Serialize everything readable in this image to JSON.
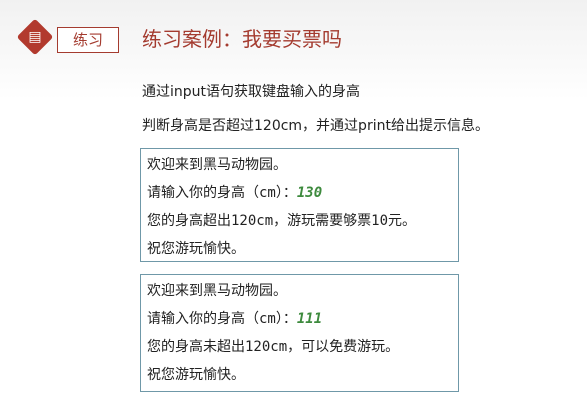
{
  "header": {
    "icon": "list-document-icon",
    "tag_label": "练习",
    "title": "练习案例：我要买票吗"
  },
  "task": {
    "line1": "通过input语句获取键盘输入的身高",
    "line2": "判断身高是否超过120cm，并通过print给出提示信息。"
  },
  "console1": {
    "welcome": "欢迎来到黑马动物园。",
    "prompt_prefix": "请输入你的身高（",
    "prompt_unit": "cm",
    "prompt_suffix": "）：",
    "input_value": "130",
    "result_a": "您的身高超出",
    "result_b": "120cm",
    "result_c": "，游玩需要够票",
    "result_d": "10",
    "result_e": "元。",
    "farewell": "祝您游玩愉快。"
  },
  "console2": {
    "welcome": "欢迎来到黑马动物园。",
    "prompt_prefix": "请输入你的身高（",
    "prompt_unit": "cm",
    "prompt_suffix": "）：",
    "input_value": "111",
    "result_a": "您的身高未超出",
    "result_b": "120cm",
    "result_c": "，可以免费游玩。",
    "farewell": "祝您游玩愉快。"
  },
  "colors": {
    "accent_red": "#a43b2f",
    "input_green": "#3d8a3d",
    "box_border": "#6f98a8"
  }
}
